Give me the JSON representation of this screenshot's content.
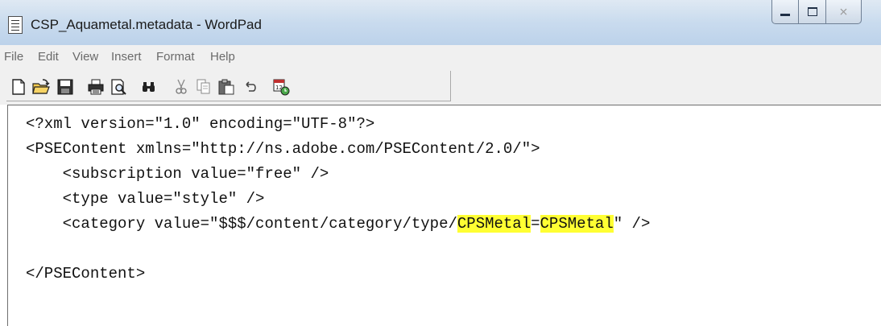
{
  "window": {
    "title": "CSP_Aquametal.metadata - WordPad",
    "controls": {
      "close_glyph": "⨯"
    }
  },
  "menu": {
    "items": [
      "File",
      "Edit",
      "View",
      "Insert",
      "Format",
      "Help"
    ]
  },
  "toolbar": {
    "buttons": [
      "new-document-icon",
      "open-folder-icon",
      "save-icon",
      "print-icon",
      "print-preview-icon",
      "find-icon",
      "cut-icon",
      "copy-icon",
      "paste-icon",
      "undo-icon",
      "insert-date-time-icon"
    ]
  },
  "document": {
    "line1": "<?xml version=\"1.0\" encoding=\"UTF-8\"?>",
    "line2": "<PSEContent xmlns=\"http://ns.adobe.com/PSEContent/2.0/\">",
    "line3": "    <subscription value=\"free\" />",
    "line4": "    <type value=\"style\" />",
    "line5_prefix": "    <category value=\"$$$/content/category/type/",
    "line5_hl1": "CPSMetal",
    "line5_eq": "=",
    "line5_hl2": "CPSMetal",
    "line5_suffix": "\" />",
    "line7": "</PSEContent>",
    "highlight_color": "#ffff33"
  }
}
